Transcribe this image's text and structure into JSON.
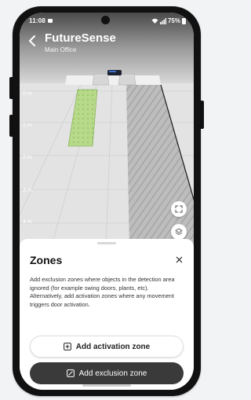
{
  "status_bar": {
    "time": "11:08",
    "battery": "75%"
  },
  "header": {
    "title": "FutureSense",
    "subtitle": "Main Office"
  },
  "scene": {
    "axis_labels": [
      "0 m",
      "1 m",
      "2 m",
      "3 m",
      "4 m"
    ],
    "activation_zone_color": "#a8d070",
    "exclusion_zone_color": "#c0c0c0",
    "floor_color": "#e8e8e8"
  },
  "sheet": {
    "title": "Zones",
    "description": "Add exclusion zones where objects in the detection area ignored (for example swing doors, plants, etc).\nAlternatively, add activation zones where any movement triggers door activation.",
    "activation_button_label": "Add activation zone",
    "exclusion_button_label": "Add exclusion zone"
  },
  "icons": {
    "back": "chevron-left-icon",
    "close": "close-icon",
    "expand": "expand-icon",
    "layers": "layers-icon",
    "add_box": "plus-square-icon",
    "edit_box": "pencil-square-icon"
  },
  "colors": {
    "exclusion_button_bg": "#3a3a3a",
    "activation_button_bg": "#ffffff",
    "phone_frame": "#111111"
  }
}
